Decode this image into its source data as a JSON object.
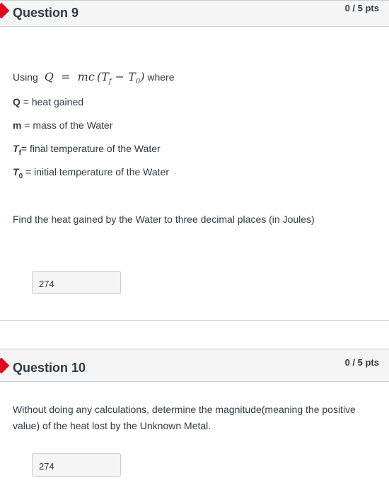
{
  "questions": [
    {
      "title": "Question 9",
      "points": "0 / 5 pts",
      "formula_intro": "Using",
      "formula_where": "where",
      "definitions": [
        {
          "symbol": "Q",
          "text": " = heat gained"
        },
        {
          "symbol": "m",
          "text": " = mass of the Water"
        },
        {
          "symbol": "T",
          "sub": "f",
          "text": "= final temperature of the Water"
        },
        {
          "symbol": "T",
          "sub": "0",
          "text": " = initial temperature of the Water"
        }
      ],
      "prompt": "Find the heat gained by the Water to three decimal places (in Joules)",
      "answer": "274"
    },
    {
      "title": "Question 10",
      "points": "0 / 5 pts",
      "prompt_line1": "Without doing any calculations, determine the magnitude(meaning the positive",
      "prompt_line2": "value) of the heat lost by the Unknown Metal.",
      "answer": "274"
    }
  ],
  "colors": {
    "flag": "#e0061f",
    "header_bg": "#f5f5f5",
    "text": "#2d3b45",
    "border": "#c7cdd1"
  }
}
